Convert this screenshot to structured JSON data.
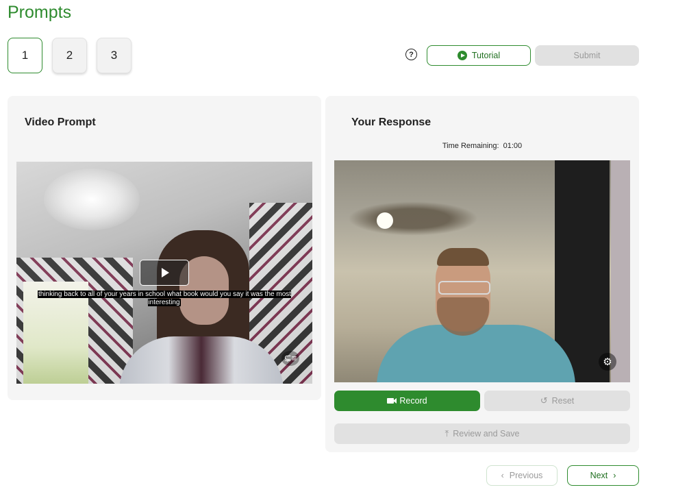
{
  "page": {
    "title": "Prompts"
  },
  "prompt_tabs": [
    {
      "label": "1",
      "active": true
    },
    {
      "label": "2",
      "active": false
    },
    {
      "label": "3",
      "active": false
    }
  ],
  "toolbar": {
    "help_icon": "question-circle-icon",
    "tutorial_label": "Tutorial",
    "tutorial_icon": "play-circle-icon",
    "submit_label": "Submit"
  },
  "video_prompt": {
    "title": "Video Prompt",
    "caption": "thinking back to all of your years in school what book would you say it was the most interesting",
    "play_icon": "play-icon",
    "captions_icon": "closed-captions-icon"
  },
  "response": {
    "title": "Your Response",
    "time_label": "Time Remaining:",
    "time_value": "01:00",
    "settings_icon": "gear-icon",
    "record_label": "Record",
    "record_icon": "video-camera-icon",
    "reset_label": "Reset",
    "reset_icon": "undo-icon",
    "review_label": "Review and Save",
    "review_icon": "upload-icon"
  },
  "navigation": {
    "previous_label": "Previous",
    "next_label": "Next"
  },
  "colors": {
    "accent": "#2e8b2e",
    "disabled_bg": "#e1e1e1",
    "disabled_text": "#9a9a9a",
    "panel_bg": "#f5f5f5"
  }
}
